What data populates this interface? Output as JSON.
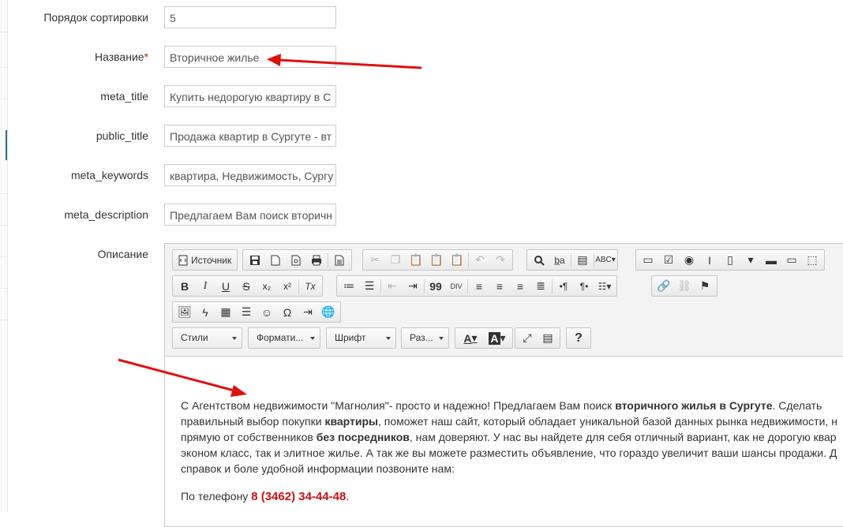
{
  "form": {
    "sort": {
      "label": "Порядок сортировки",
      "value": "5"
    },
    "name": {
      "label": "Название",
      "required": "*",
      "value": "Вторичное жилье"
    },
    "meta_title": {
      "label": "meta_title",
      "value": "Купить недорогую квартиру в С"
    },
    "public_title": {
      "label": "public_title",
      "value": "Продажа квартир в Сургуте - вт"
    },
    "meta_keywords": {
      "label": "meta_keywords",
      "value": "квартира, Недвижимость, Сургу"
    },
    "meta_description": {
      "label": "meta_description",
      "value": "Предлагаем Вам поиск вторичн"
    },
    "description": {
      "label": "Описание"
    }
  },
  "editor": {
    "toolbar": {
      "source_label": "Источник",
      "bold": "B",
      "italic": "I",
      "underline": "U",
      "strike": "S",
      "sub": "x₂",
      "sup": "x²",
      "clear": "Tx",
      "quote": "99",
      "div": "DIV",
      "omega": "Ω",
      "help": "?",
      "text_color": "A",
      "bg_color": "A",
      "styles": "Стили",
      "format": "Формати...",
      "font": "Шрифт",
      "size": "Раз..."
    },
    "content": {
      "p1_a": "С Агентством недвижимости \"Магнолия\"- просто и надежно! Предлагаем Вам поиск ",
      "p1_b": "вторичного жилья в Сургуте",
      "p1_c": ". Сделать",
      "p2_a": "правильный выбор покупки ",
      "p2_b": "квартиры",
      "p2_c": ", поможет наш сайт, который обладает уникальной базой данных рынка недвижимости, н",
      "p3_a": "прямую от собственников ",
      "p3_b": "без посредников",
      "p3_c": ", нам доверяют. У нас вы найдете для себя отличный вариант, как не дорогую квар",
      "p4": "эконом класс, так и элитное жилье. А так же вы можете разместить объявление, что гораздо увеличит ваши шансы продажи. Д",
      "p5": "справок и боле удобной информации позвоните нам:",
      "phone_prefix": "По телефону ",
      "phone": "8 (3462) 34-44-48",
      "phone_suffix": "."
    }
  },
  "annotation_color": "#e01010"
}
